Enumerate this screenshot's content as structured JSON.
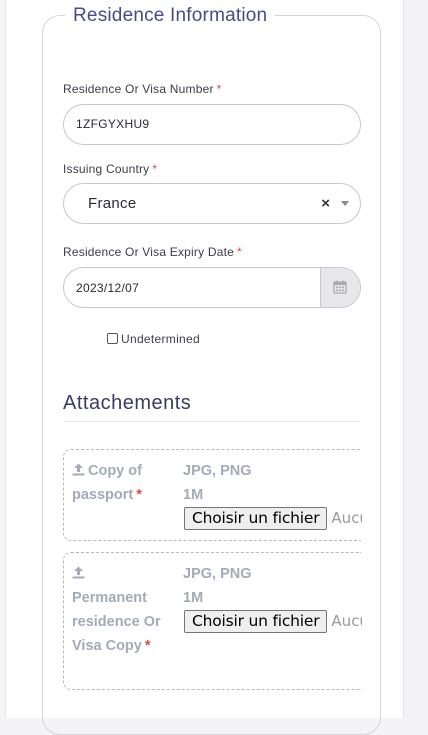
{
  "section": {
    "title": "Residence Information"
  },
  "visa_number": {
    "label": "Residence Or Visa Number",
    "required_mark": "*",
    "value": "1ZFGYXHU9"
  },
  "issuing_country": {
    "label": "Issuing Country",
    "required_mark": "*",
    "value": "France",
    "clear_label": "×"
  },
  "expiry_date": {
    "label": "Residence Or Visa Expiry Date",
    "required_mark": "*",
    "value": "2023/12/07"
  },
  "undetermined": {
    "label": "Undetermined",
    "checked": false
  },
  "attachments": {
    "title": "Attachements",
    "items": [
      {
        "label": "Copy of passport",
        "required_mark": "*",
        "formats": "JPG, PNG",
        "size": "1M",
        "button_label": "Choisir un fichier",
        "status": "Aucun fichier choisi"
      },
      {
        "label": "Permanent residence Or Visa Copy",
        "required_mark": "*",
        "formats": "JPG, PNG",
        "size": "1M",
        "button_label": "Choisir un fichier",
        "status": "Aucun fichier choisi"
      }
    ]
  }
}
